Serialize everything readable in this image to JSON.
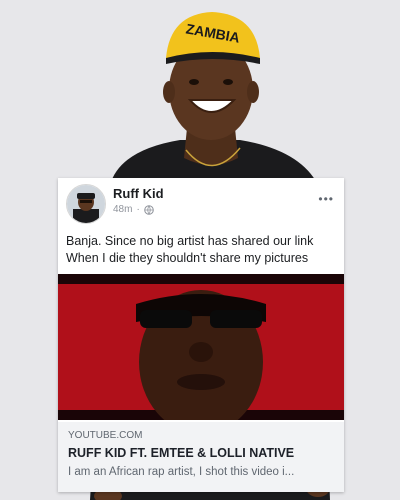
{
  "photo": {
    "cap_text": "ZAMBIA",
    "description_icon": "man-in-yellow-cap"
  },
  "post": {
    "author": "Ruff Kid",
    "time": "48m",
    "separator": "·",
    "privacy_icon": "globe-icon",
    "more_label": "•••",
    "text_lines": [
      "Banja. Since no big artist has shared our link",
      "When I die they shouldn't share my pictures"
    ]
  },
  "link_preview": {
    "domain": "YOUTUBE.COM",
    "title": "RUFF KID FT. EMTEE & LOLLI NATIVE",
    "description": "I am an African rap artist, I shot this video i..."
  },
  "colors": {
    "background": "#e7e7ea",
    "cap_yellow": "#f2c21c",
    "video_red": "#b0101a",
    "shirt": "#1b1b1d",
    "skin": "#5a3620"
  }
}
